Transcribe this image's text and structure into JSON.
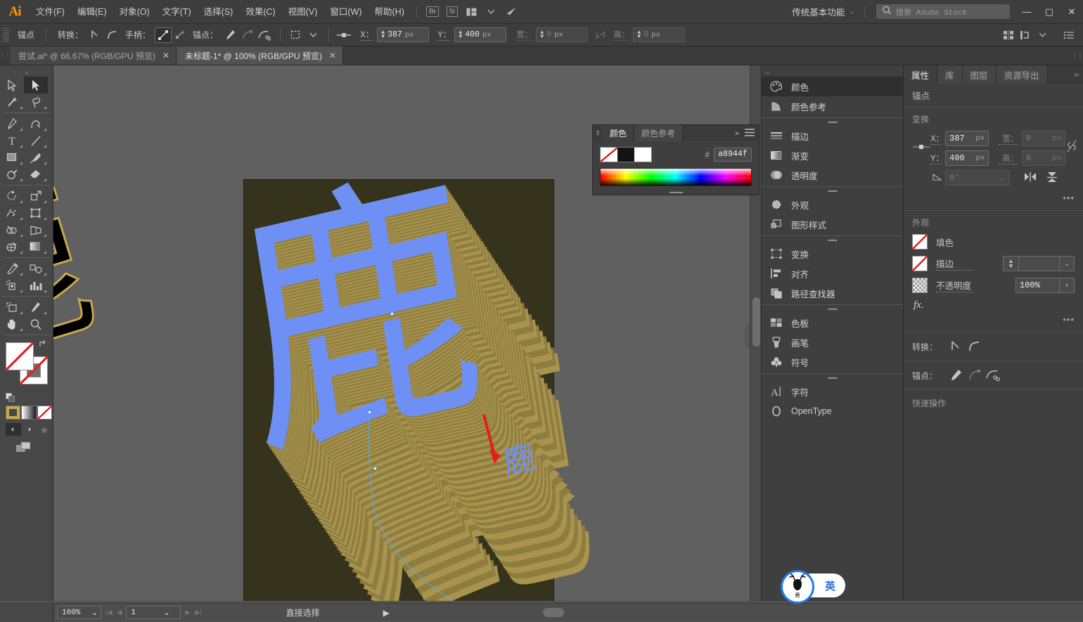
{
  "app": {
    "name": "Adobe Illustrator",
    "logo_text": "Ai"
  },
  "menubar": {
    "items": [
      {
        "label": "文件(F)",
        "name": "file"
      },
      {
        "label": "编辑(E)",
        "name": "edit"
      },
      {
        "label": "对象(O)",
        "name": "object"
      },
      {
        "label": "文字(T)",
        "name": "type"
      },
      {
        "label": "选择(S)",
        "name": "select"
      },
      {
        "label": "效果(C)",
        "name": "effect"
      },
      {
        "label": "视图(V)",
        "name": "view"
      },
      {
        "label": "窗口(W)",
        "name": "window"
      },
      {
        "label": "帮助(H)",
        "name": "help"
      }
    ],
    "bridge_label": "Br",
    "stock_label": "St",
    "arrange_icon": "arrange-documents-icon",
    "home_icon": "illustrator-home-icon",
    "workspace": "传统基本功能",
    "search_placeholder": "搜索 Adobe Stock",
    "window_minimize": "—",
    "window_maximize": "▢",
    "window_close": "✕"
  },
  "controlbar": {
    "object_label": "锚点",
    "convert_label": "转换：",
    "handles_label": "手柄：",
    "anchor_label": "锚点：",
    "x_label": "X：",
    "x_value": "387",
    "x_unit": "px",
    "y_label": "Y：",
    "y_value": "400",
    "y_unit": "px",
    "w_label": "宽：",
    "w_value": "0",
    "w_unit": "px",
    "h_label": "高：",
    "h_value": "0",
    "h_unit": "px",
    "lock_icon": "unlink-proportions-icon",
    "icons": [
      "convert-to-corner-icon",
      "convert-to-smooth-icon",
      "show-handles-icon",
      "hide-handles-icon",
      "anchor-add-icon",
      "anchor-remove-icon",
      "anchor-cut-icon",
      "transform-bounds-icon",
      "align-icon"
    ],
    "right_icons": [
      "align-panel-icon",
      "arrange-panel-icon",
      "options-menu-icon"
    ]
  },
  "tabs": [
    {
      "title": "尝试.ai* @ 66.67% (RGB/GPU 预览)",
      "active": false,
      "close": "✕"
    },
    {
      "title": "未标题-1* @ 100% (RGB/GPU 预览)",
      "active": true,
      "close": "✕"
    }
  ],
  "toolbar": {
    "tools": [
      {
        "name": "selection-tool",
        "glyph": "selection"
      },
      {
        "name": "direct-selection-tool",
        "glyph": "direct-selection",
        "selected": true
      },
      {
        "name": "magic-wand-tool",
        "glyph": "magic-wand"
      },
      {
        "name": "lasso-tool",
        "glyph": "lasso"
      },
      {
        "name": "pen-tool",
        "glyph": "pen"
      },
      {
        "name": "curvature-tool",
        "glyph": "curvature"
      },
      {
        "name": "type-tool",
        "glyph": "type"
      },
      {
        "name": "line-segment-tool",
        "glyph": "line"
      },
      {
        "name": "rectangle-tool",
        "glyph": "rectangle"
      },
      {
        "name": "paintbrush-tool",
        "glyph": "paintbrush"
      },
      {
        "name": "shaper-tool",
        "glyph": "shaper"
      },
      {
        "name": "eraser-tool",
        "glyph": "eraser"
      },
      {
        "name": "rotate-tool",
        "glyph": "rotate"
      },
      {
        "name": "scale-tool",
        "glyph": "scale"
      },
      {
        "name": "width-tool",
        "glyph": "width"
      },
      {
        "name": "free-transform-tool",
        "glyph": "free-transform"
      },
      {
        "name": "shape-builder-tool",
        "glyph": "shape-builder"
      },
      {
        "name": "perspective-grid-tool",
        "glyph": "perspective-grid"
      },
      {
        "name": "mesh-tool",
        "glyph": "mesh"
      },
      {
        "name": "gradient-tool",
        "glyph": "gradient"
      },
      {
        "name": "eyedropper-tool",
        "glyph": "eyedropper"
      },
      {
        "name": "blend-tool",
        "glyph": "blend"
      },
      {
        "name": "symbol-sprayer-tool",
        "glyph": "symbol-sprayer"
      },
      {
        "name": "column-graph-tool",
        "glyph": "column-graph"
      },
      {
        "name": "artboard-tool",
        "glyph": "artboard"
      },
      {
        "name": "slice-tool",
        "glyph": "slice"
      },
      {
        "name": "hand-tool",
        "glyph": "hand"
      },
      {
        "name": "zoom-tool",
        "glyph": "zoom"
      }
    ],
    "fill_swatch": "none",
    "stroke_swatch": "none",
    "swap_icon": "swap-fill-stroke-icon",
    "default_icon": "default-fill-stroke-icon",
    "color_mode": "color-button",
    "gradient_mode": "gradient-button",
    "none_mode": "none-button",
    "draw_normal": "draw-normal-button",
    "draw_behind": "draw-behind-button",
    "draw_inside": "draw-inside-button",
    "screen_mode": "change-screen-mode-button"
  },
  "color_panel": {
    "tabs": [
      {
        "label": "颜色",
        "active": true
      },
      {
        "label": "颜色参考",
        "active": false
      }
    ],
    "expand_icon": "»",
    "menu_icon": "panel-menu-icon",
    "hash_label": "#",
    "hex_value": "a8944f",
    "fill_swatch": "none",
    "black_swatch": "#141414",
    "white_swatch": "#ffffff",
    "spectrum": "color-spectrum-ramp"
  },
  "dock": {
    "groups": [
      [
        {
          "label": "颜色",
          "icon": "color-panel-icon",
          "active": true
        },
        {
          "label": "颜色参考",
          "icon": "color-guide-icon",
          "active": false
        }
      ],
      [
        {
          "label": "描边",
          "icon": "stroke-panel-icon"
        },
        {
          "label": "渐变",
          "icon": "gradient-panel-icon"
        },
        {
          "label": "透明度",
          "icon": "transparency-panel-icon"
        }
      ],
      [
        {
          "label": "外观",
          "icon": "appearance-panel-icon"
        },
        {
          "label": "图形样式",
          "icon": "graphic-styles-panel-icon"
        }
      ],
      [
        {
          "label": "变换",
          "icon": "transform-panel-icon"
        },
        {
          "label": "对齐",
          "icon": "align-panel-icon"
        },
        {
          "label": "路径查找器",
          "icon": "pathfinder-panel-icon"
        }
      ],
      [
        {
          "label": "色板",
          "icon": "swatches-panel-icon"
        },
        {
          "label": "画笔",
          "icon": "brushes-panel-icon"
        },
        {
          "label": "符号",
          "icon": "symbols-panel-icon"
        }
      ],
      [
        {
          "label": "字符",
          "icon": "character-panel-icon"
        },
        {
          "label": "OpenType",
          "icon": "opentype-panel-icon"
        }
      ]
    ]
  },
  "properties": {
    "tabs": [
      {
        "label": "属性",
        "active": true
      },
      {
        "label": "库",
        "active": false
      },
      {
        "label": "图层",
        "active": false
      },
      {
        "label": "资源导出",
        "active": false
      }
    ],
    "collapse_icon": "collapse-panel-icon",
    "object_type": "锚点",
    "transform": {
      "title": "变换",
      "reference_point": "reference-point-widget",
      "x_label": "X：",
      "x_value": "387",
      "x_unit": "px",
      "y_label": "Y：",
      "y_value": "400",
      "y_unit": "px",
      "w_label": "宽：",
      "w_value": "0",
      "w_unit": "px",
      "h_label": "高：",
      "h_value": "0",
      "h_unit": "px",
      "angle_label": "角度",
      "angle_value": "0°",
      "link_icon": "unlink-proportions-icon",
      "flip_h_icon": "flip-horizontal-icon",
      "flip_v_icon": "flip-vertical-icon",
      "more_icon": "more-options-icon"
    },
    "appearance": {
      "title": "外观",
      "fill_label": "填色",
      "fill_value": "none",
      "stroke_label": "描边",
      "stroke_value": "none",
      "stroke_weight": "",
      "opacity_label": "不透明度",
      "opacity_value": "100%",
      "fx_label": "fx.",
      "more_icon": "more-options-icon"
    },
    "convert_row": {
      "label": "转换：",
      "icons": [
        "convert-to-corner-icon",
        "convert-to-smooth-icon"
      ]
    },
    "anchor_row": {
      "label": "锚点：",
      "icons": [
        "add-anchor-icon",
        "remove-anchor-icon",
        "cut-path-icon"
      ]
    },
    "quick_actions": "快速操作"
  },
  "canvas": {
    "artboard_background": "#35331c",
    "pasteboard_background": "#606060",
    "artwork_character": "鹿",
    "front_color": "#6e90f5",
    "extrude_color": "#a8944f",
    "outline_color": "#c8a84b",
    "pasteboard_character": "鹿",
    "pasteboard_char_color": "#000000",
    "annotation_arrow": "red-arrow-annotation",
    "selection_path": "bezier-selection-path",
    "anchor_points": [
      "anchor-point-1",
      "anchor-point-2",
      "anchor-point-3"
    ]
  },
  "ime": {
    "logo": "deer-antler-logo",
    "logo_text": "鹿",
    "mode_label": "英",
    "accent": "#1f7ce8"
  },
  "statusbar": {
    "zoom_value": "100%",
    "zoom_caret": "⌄",
    "first_icon": "first-artboard-icon",
    "prev_icon": "previous-artboard-icon",
    "page_value": "1",
    "page_caret": "⌄",
    "next_icon": "next-artboard-icon",
    "last_icon": "last-artboard-icon",
    "current_tool": "直接选择",
    "expand_icon": "▶",
    "collapse_icon": "‹"
  }
}
